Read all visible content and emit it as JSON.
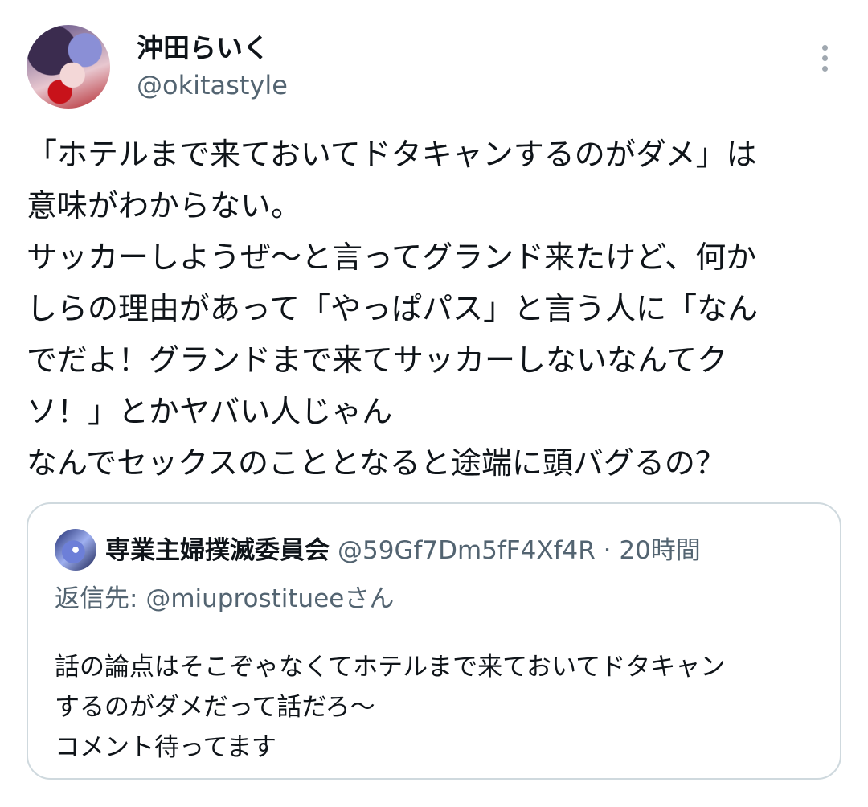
{
  "tweet": {
    "display_name": "沖田らいく",
    "handle": "@okitastyle",
    "text": "「ホテルまで来ておいてドタキャンするのがダメ」は\n意味がわからない。\nサッカーしようぜ〜と言ってグランド来たけど、何か\nしらの理由があって「やっぱパス」と言う人に「なん\nでだよ！グランドまで来てサッカーしないなんてク\nソ！」とかヤバい人じゃん\nなんでセックスのこととなると途端に頭バグるの？"
  },
  "quote": {
    "display_name": "専業主婦撲滅委員会",
    "meta": "@59Gf7Dm5fF4Xf4R · 20時間",
    "reply_prefix": "返信先: ",
    "reply_mention": "@miuprostituee",
    "reply_suffix": "さん",
    "text": "話の論点はそこぞゃなくてホテルまで来ておいてドタキャン\nするのがダメだって話だろ〜\nコメント待ってます"
  },
  "icons": {
    "more": "more-vertical-icon",
    "avatar": "user-avatar",
    "quote_avatar": "quoted-user-avatar"
  },
  "colors": {
    "text": "#0f1419",
    "secondary": "#536471",
    "border": "#cfd9de"
  }
}
